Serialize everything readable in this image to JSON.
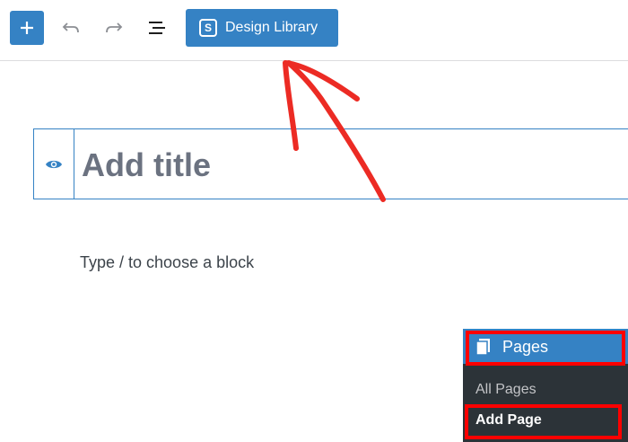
{
  "toolbar": {
    "add_block": "+",
    "undo": "undo",
    "redo": "redo",
    "list_view": "list view",
    "design_library_label": "Design Library",
    "design_library_badge": "S"
  },
  "editor": {
    "title_placeholder": "Add title",
    "block_placeholder": "Type / to choose a block"
  },
  "admin_menu": {
    "pages_label": "Pages",
    "all_pages": "All Pages",
    "add_page": "Add Page"
  },
  "colors": {
    "accent": "#3582c4",
    "annotation": "#ff0000",
    "menu_bg": "#2c3338"
  }
}
